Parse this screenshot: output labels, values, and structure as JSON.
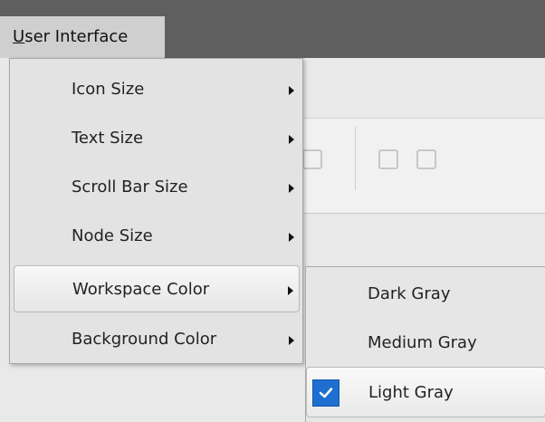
{
  "menu_bar": {
    "title": "User Interface",
    "mnemonic": "U"
  },
  "menu": {
    "items": [
      {
        "label": "Icon Size",
        "has_submenu": true
      },
      {
        "label": "Text Size",
        "has_submenu": true
      },
      {
        "label": "Scroll Bar Size",
        "has_submenu": true
      },
      {
        "label": "Node Size",
        "has_submenu": true
      },
      {
        "label": "Workspace Color",
        "has_submenu": true,
        "active": true
      },
      {
        "label": "Background Color",
        "has_submenu": true
      }
    ]
  },
  "submenu": {
    "items": [
      {
        "label": "Dark Gray",
        "checked": false
      },
      {
        "label": "Medium Gray",
        "checked": false
      },
      {
        "label": "Light Gray",
        "checked": true
      }
    ]
  },
  "icons": {
    "checkmark": "check-icon",
    "submenu_arrow": "chevron-right-icon"
  },
  "colors": {
    "checkbox_accent": "#1f6fd1"
  }
}
